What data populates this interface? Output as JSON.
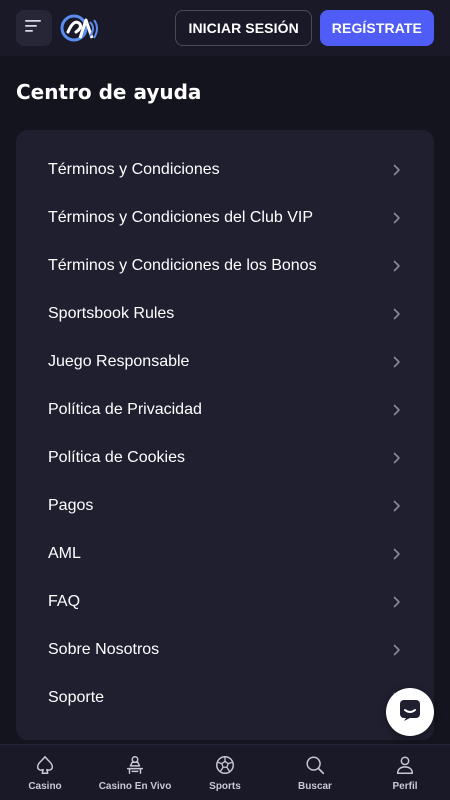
{
  "header": {
    "menu_icon": "hamburger-menu-icon",
    "logo_icon": "brand-logo-icon",
    "login_label": "INICIAR SESIÓN",
    "register_label": "REGÍSTRATE",
    "accent_color": "#4f5cf6"
  },
  "page": {
    "title": "Centro de ayuda"
  },
  "help_items": [
    {
      "label": "Términos y Condiciones"
    },
    {
      "label": "Términos y Condiciones del Club VIP"
    },
    {
      "label": "Términos y Condiciones de los Bonos"
    },
    {
      "label": "Sportsbook Rules"
    },
    {
      "label": "Juego Responsable"
    },
    {
      "label": "Política de Privacidad"
    },
    {
      "label": "Política de Cookies"
    },
    {
      "label": "Pagos"
    },
    {
      "label": "AML"
    },
    {
      "label": "FAQ"
    },
    {
      "label": "Sobre Nosotros"
    },
    {
      "label": "Soporte"
    }
  ],
  "chat": {
    "icon": "chat-bubble-icon"
  },
  "bottom_nav": [
    {
      "label": "Casino",
      "icon": "spade-icon"
    },
    {
      "label": "Casino En Vivo",
      "icon": "live-dealer-icon"
    },
    {
      "label": "Sports",
      "icon": "soccer-ball-icon"
    },
    {
      "label": "Buscar",
      "icon": "search-icon"
    },
    {
      "label": "Perfil",
      "icon": "user-icon"
    }
  ]
}
